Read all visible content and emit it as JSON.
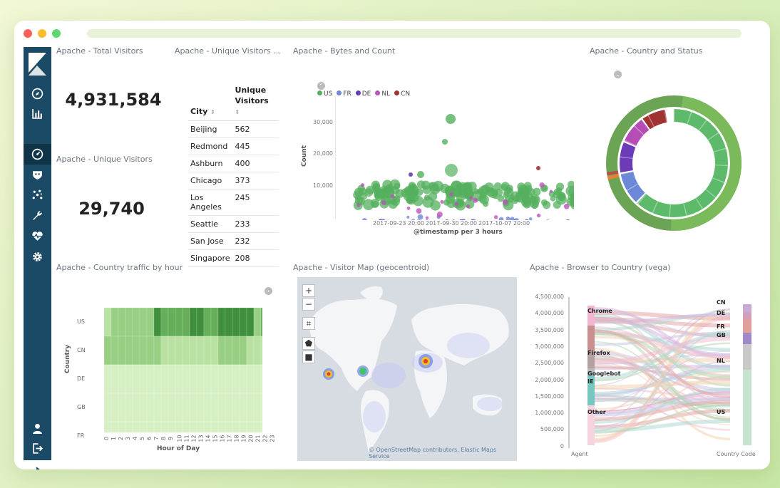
{
  "colors": {
    "sidebar": "#1a4a65",
    "US": "#54b05e",
    "FR": "#6f87d8",
    "DE": "#663db8",
    "NL": "#bc52bc",
    "CN": "#9e3533"
  },
  "sidebar": {
    "icons": [
      "compass-icon",
      "bar-chart-icon",
      "dashboard-icon",
      "shield-icon",
      "graph-icon",
      "wrench-icon",
      "heartbeat-icon",
      "gear-icon"
    ],
    "bottom_icons": [
      "user-icon",
      "logout-icon",
      "collapse-icon"
    ]
  },
  "panels": {
    "total_visitors": {
      "title": "Apache - Total Visitors",
      "value": "4,931,584"
    },
    "unique_visitors": {
      "title": "Apache - Unique Visitors",
      "value": "29,740"
    },
    "unique_table": {
      "title": "Apache - Unique Visitors ...",
      "col_city": "City",
      "col_unique": "Unique\nVisitors",
      "rows": [
        {
          "city": "Beijing",
          "value": "562"
        },
        {
          "city": "Redmond",
          "value": "445"
        },
        {
          "city": "Ashburn",
          "value": "400"
        },
        {
          "city": "Chicago",
          "value": "373"
        },
        {
          "city": "Los\nAngeles",
          "value": "245"
        },
        {
          "city": "Seattle",
          "value": "233"
        },
        {
          "city": "San Jose",
          "value": "232"
        },
        {
          "city": "Singapore",
          "value": "208"
        }
      ]
    },
    "bytes_count": {
      "title": "Apache - Bytes and Count",
      "legend": [
        "US",
        "FR",
        "DE",
        "NL",
        "CN"
      ],
      "ylabel": "Count",
      "xlabel": "@timestamp per 3 hours",
      "yticks": [
        "30,000",
        "20,000",
        "10,000"
      ],
      "xticks": [
        "2017-09-23 20:00",
        "2017-09-30 20:00",
        "2017-10-07 20:00"
      ]
    },
    "country_status": {
      "title": "Apache - Country and Status"
    },
    "traffic_hour": {
      "title": "Apache - Country traffic by hour",
      "ylabel": "Country",
      "xlabel": "Hour of Day",
      "rows": [
        "US",
        "CN",
        "DE",
        "GB",
        "FR"
      ],
      "hours": [
        "0",
        "1",
        "2",
        "3",
        "4",
        "5",
        "6",
        "7",
        "8",
        "9",
        "10",
        "11",
        "12",
        "13",
        "14",
        "15",
        "16",
        "17",
        "18",
        "19",
        "20",
        "21",
        "22",
        "23"
      ]
    },
    "visitor_map": {
      "title": "Apache - Visitor Map (geocentroid)",
      "zoom_in": "+",
      "zoom_out": "−",
      "credit": "© OpenStreetMap contributors, Elastic Maps Service"
    },
    "browser_country": {
      "title": "Apache - Browser to Country (vega)",
      "yticks": [
        "4,500,000",
        "4,000,000",
        "3,500,000",
        "3,000,000",
        "2,500,000",
        "2,000,000",
        "1,500,000",
        "1,000,000",
        "500,000",
        "0"
      ],
      "agents": [
        "Chrome",
        "Firefox",
        "Googlebot",
        "IE",
        "Other"
      ],
      "countries": [
        "CN",
        "DE",
        "FR",
        "GB",
        "NL",
        "US"
      ],
      "x_left": "Agent",
      "x_right": "Country Code"
    }
  }
}
